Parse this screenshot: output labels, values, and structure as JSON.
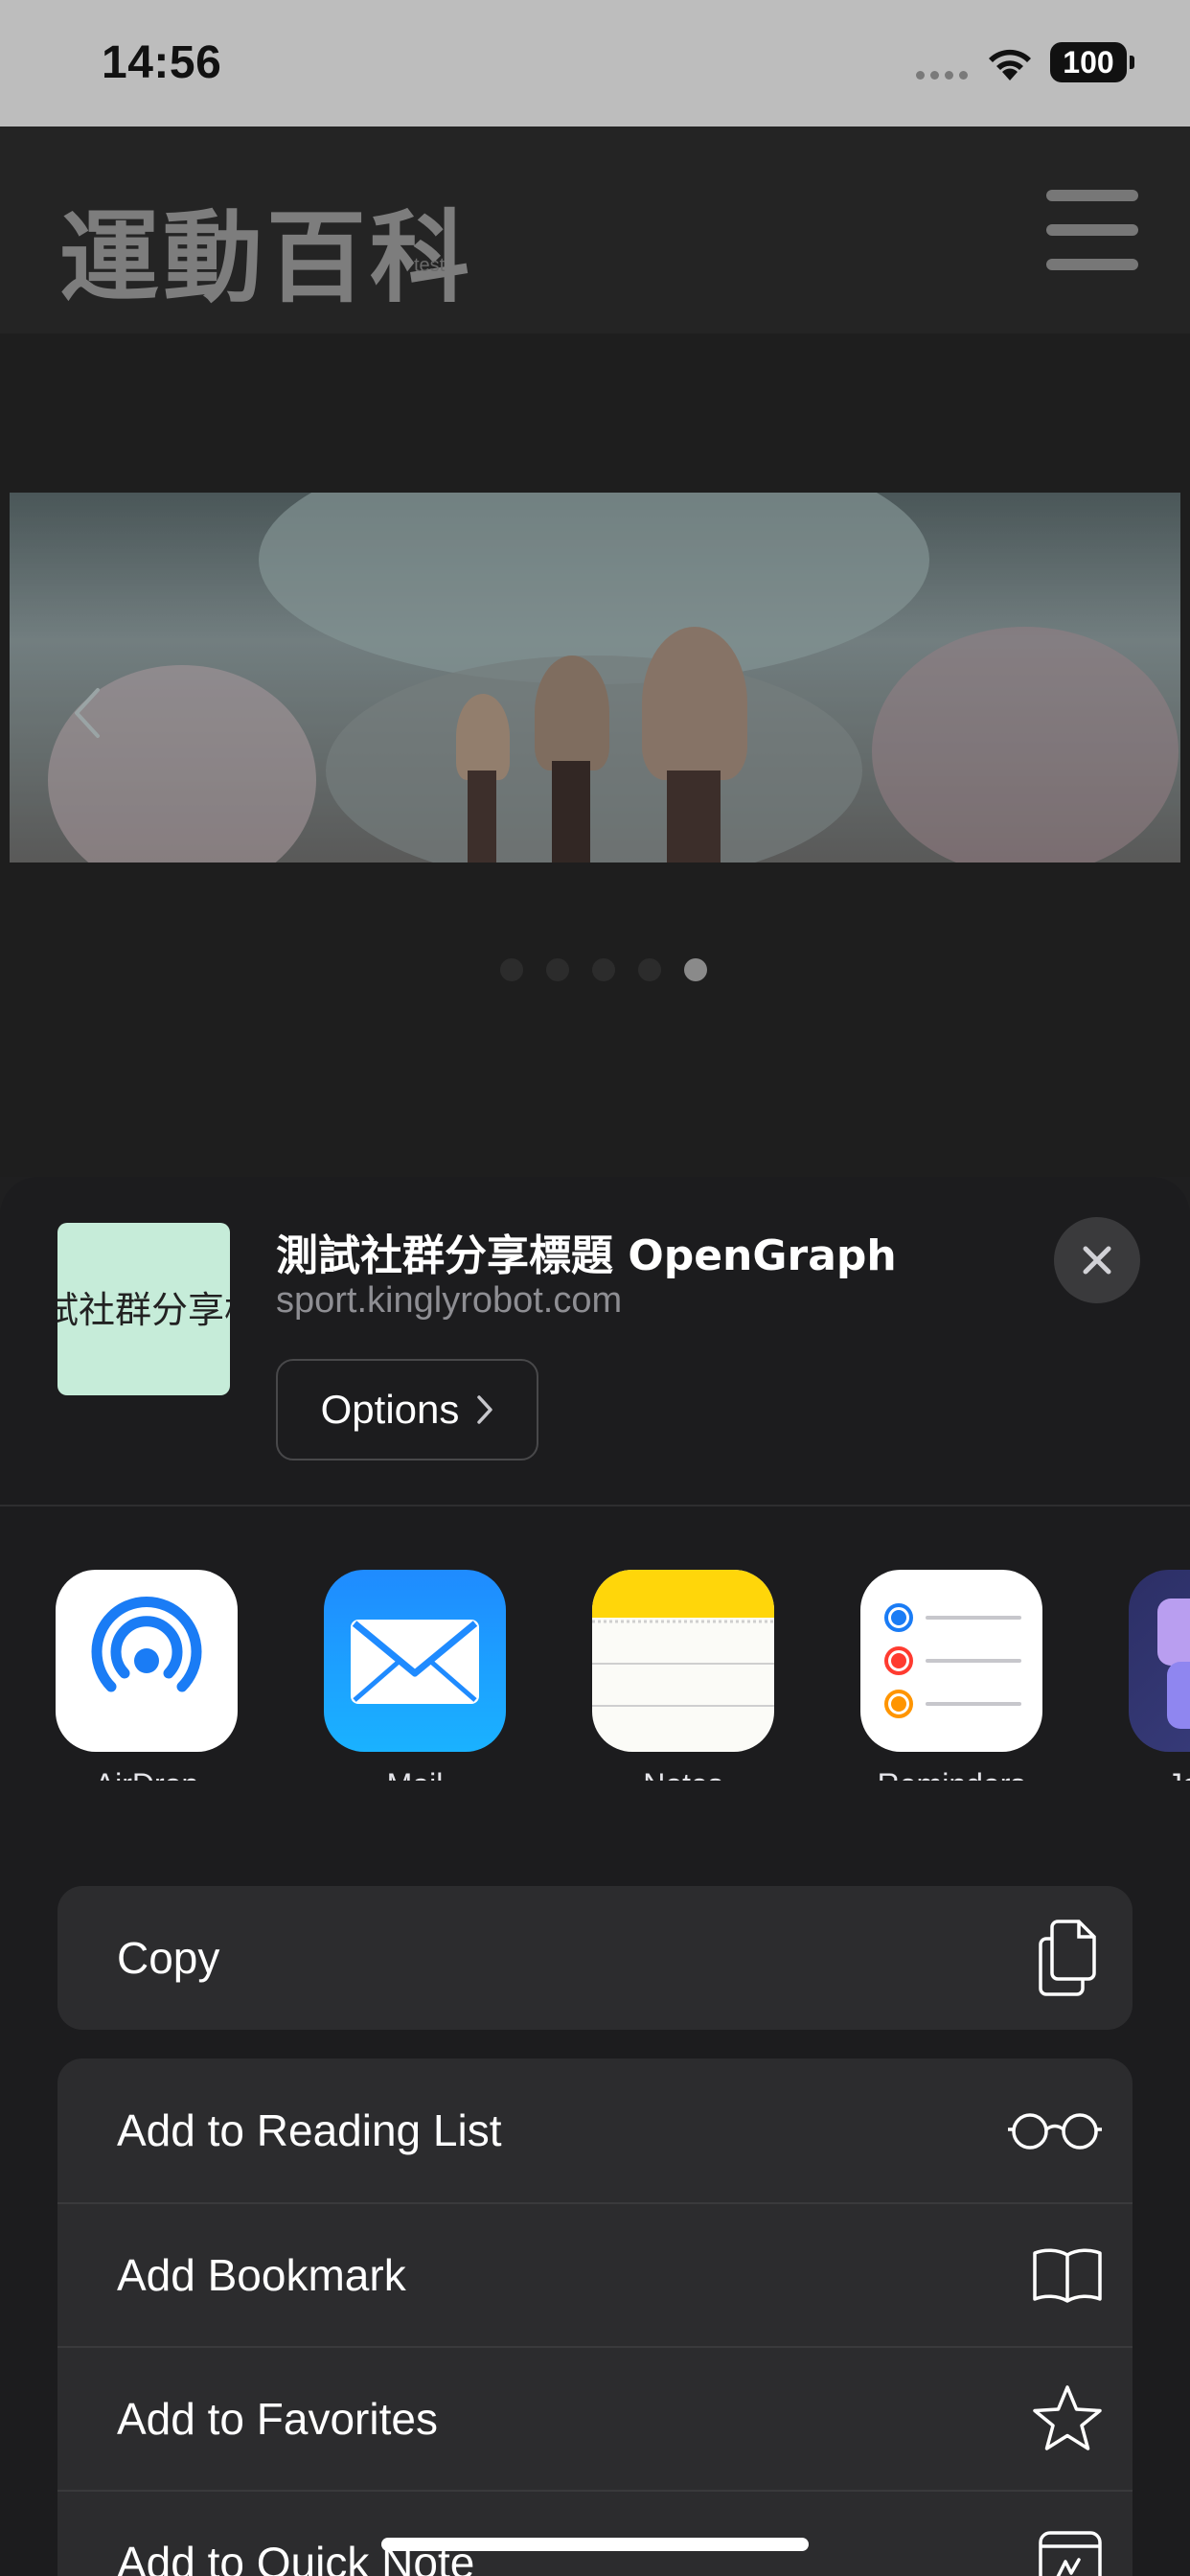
{
  "status_bar": {
    "time": "14:56",
    "battery": "100"
  },
  "site": {
    "logo": "運動百科",
    "logo_sub": "test"
  },
  "carousel": {
    "pages": 5,
    "active_index": 4
  },
  "share": {
    "thumbnail_text": "試社群分享標",
    "title": "測試社群分享標題 OpenGraph",
    "url": "sport.kinglyrobot.com",
    "options_label": "Options"
  },
  "apps": [
    {
      "name": "airdrop-icon",
      "label": "AirDrop"
    },
    {
      "name": "mail-icon",
      "label": "Mail"
    },
    {
      "name": "notes-icon",
      "label": "Notes"
    },
    {
      "name": "reminders-icon",
      "label": "Reminders"
    },
    {
      "name": "journal-icon",
      "label": "Jo"
    }
  ],
  "actions": {
    "copy": {
      "label": "Copy",
      "icon": "copy-icon"
    },
    "list": [
      {
        "label": "Add to Reading List",
        "icon": "glasses-icon"
      },
      {
        "label": "Add Bookmark",
        "icon": "book-icon"
      },
      {
        "label": "Add to Favorites",
        "icon": "star-icon"
      },
      {
        "label": "Add to Quick Note",
        "icon": "quick-note-icon"
      }
    ]
  },
  "colors": {
    "mail_blue": "#1a8cff",
    "notes_yellow": "#ffd60a",
    "sheet_bg": "#1c1c1e",
    "row_bg": "#2c2c2e"
  }
}
